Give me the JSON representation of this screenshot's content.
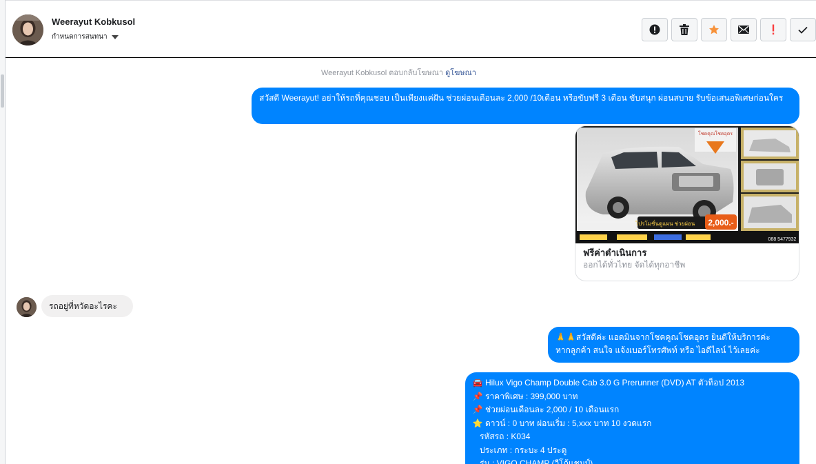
{
  "header": {
    "contact_name": "Weerayut Kobkusol",
    "assign_label": "กำหนดการสนทนา"
  },
  "actions": [
    {
      "name": "spam-report-button",
      "icon": "alert-circle-icon"
    },
    {
      "name": "delete-button",
      "icon": "trash-icon"
    },
    {
      "name": "star-button",
      "icon": "star-icon",
      "color": "#f7923b"
    },
    {
      "name": "mark-unread-button",
      "icon": "envelope-icon"
    },
    {
      "name": "mark-important-button",
      "icon": "exclamation-icon",
      "color": "#fa3e3e"
    },
    {
      "name": "mark-done-button",
      "icon": "check-icon"
    }
  ],
  "system_notice": {
    "text": "Weerayut Kobkusol ตอบกลับโฆษณา",
    "link": "ดูโฆษณา"
  },
  "messages": {
    "ad_greeting": "สวัสดี Weerayut! อย่าให้รถที่คุณชอบ เป็นเพียงแค่ฝัน ช่วยผ่อนเดือนละ 2,000 /10เดือน หรือขับฟรี 3 เดือน ขับสนุก ผ่อนสบาย รับข้อเสนอพิเศษก่อนใคร",
    "ad_card": {
      "title": "ฟรีค่าดำเนินการ",
      "subtitle": "ออกได้ทั่วไทย จัดได้ทุกอาชีพ",
      "badge_price": "2,000.-",
      "image_caption": "โปรโมชั่นดูแผน ช่วยผ่อน",
      "image_headline": "โชคคุณโชคอุดร",
      "phone": "088 5477932"
    },
    "customer_question": "รถอยู่ที่หวัดอะไรคะ",
    "admin_welcome": {
      "line1": "🙏🙏สวัสดีค่ะ แอดมินจากโชคคูณโชคอุดร ยินดีให้บริการค่ะ",
      "line2": "หากลูกค้า สนใจ แจ้งเบอร์โทรศัพท์ หรือ ไอดีไลน์  ไว้เลยค่ะ"
    },
    "car_details": [
      {
        "emoji": "🚘",
        "text": "Hilux Vigo Champ Double Cab 3.0 G Prerunner (DVD) AT ตัวท็อป  2013"
      },
      {
        "emoji": "📌",
        "text": "ราคาพิเศษ : 399,000 บาท"
      },
      {
        "emoji": "📌",
        "text": "ช่วยผ่อนเดือนละ 2,000 / 10 เดือนแรก"
      },
      {
        "emoji": "⭐",
        "text": "ดาวน์ : 0 บาท ผ่อนเริ่ม : 5,xxx บาท 10 งวดแรก"
      },
      {
        "emoji": "",
        "text": "รหัสรถ : K034"
      },
      {
        "emoji": "",
        "text": "ประเภท : กระบะ 4 ประตู"
      },
      {
        "emoji": "",
        "text": "รุ่น : VIGO CHAMP (วีโก้แชมป์)"
      }
    ]
  }
}
